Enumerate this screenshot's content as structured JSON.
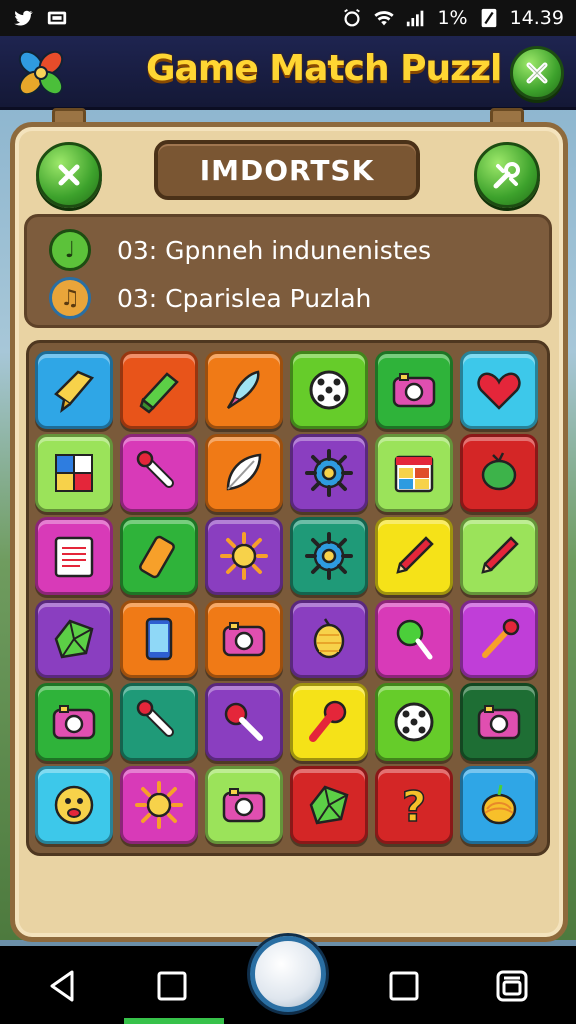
{
  "status_bar": {
    "battery_percent": "1%",
    "time": "14.39",
    "icons": [
      "twitter-icon",
      "mail-icon",
      "alarm-icon",
      "wifi-icon",
      "signal-icon",
      "battery-icon"
    ]
  },
  "header": {
    "title": "Game Match Puzzl",
    "logo_icon": "clover-leaf-icon",
    "close_icon": "close-icon"
  },
  "panel": {
    "name": "IMDORTSK",
    "close_icon": "close-icon",
    "tools_icon": "tools-icon",
    "info": [
      {
        "icon": "music-note-icon",
        "text": "03: Gpnneh indunenistes"
      },
      {
        "icon": "music-note-icon",
        "text": "03: Cparislea Puzlah"
      }
    ]
  },
  "grid": {
    "rows": 6,
    "cols": 6,
    "tiles": [
      {
        "icon": "ribbon-icon",
        "color": "#2fa6e6"
      },
      {
        "icon": "book-icon",
        "color": "#e8541a"
      },
      {
        "icon": "quill-icon",
        "color": "#f07a16"
      },
      {
        "icon": "dice-icon",
        "color": "#66cc2a"
      },
      {
        "icon": "camera-icon",
        "color": "#2fb33a"
      },
      {
        "icon": "heart-icon",
        "color": "#3dc8ea"
      },
      {
        "icon": "color-squares-icon",
        "color": "#9be35a"
      },
      {
        "icon": "brush-icon",
        "color": "#d83ab8"
      },
      {
        "icon": "feather-icon",
        "color": "#f07a16"
      },
      {
        "icon": "gear-icon",
        "color": "#8a3ec0"
      },
      {
        "icon": "calendar-icon",
        "color": "#9be35a"
      },
      {
        "icon": "fruit-icon",
        "color": "#d42626"
      },
      {
        "icon": "notepad-icon",
        "color": "#d83ab8"
      },
      {
        "icon": "battery-tile-icon",
        "color": "#2fb33a"
      },
      {
        "icon": "sun-icon",
        "color": "#8a3ec0"
      },
      {
        "icon": "gear-icon",
        "color": "#1f9a78"
      },
      {
        "icon": "pencil-icon",
        "color": "#f5e218"
      },
      {
        "icon": "pencil-icon",
        "color": "#9be35a"
      },
      {
        "icon": "gem-icon",
        "color": "#8a3ec0"
      },
      {
        "icon": "phone-icon",
        "color": "#f07a16"
      },
      {
        "icon": "camera-icon",
        "color": "#f07a16"
      },
      {
        "icon": "lemon-icon",
        "color": "#8a3ec0"
      },
      {
        "icon": "lollipop-icon",
        "color": "#d83ab8"
      },
      {
        "icon": "matchstick-icon",
        "color": "#c03ed8"
      },
      {
        "icon": "camera-icon",
        "color": "#2fb33a"
      },
      {
        "icon": "brush-icon",
        "color": "#1f9a78"
      },
      {
        "icon": "key-icon",
        "color": "#8a3ec0"
      },
      {
        "icon": "joystick-icon",
        "color": "#f5e218"
      },
      {
        "icon": "dice-icon",
        "color": "#66cc2a"
      },
      {
        "icon": "camera-icon",
        "color": "#1e6e34"
      },
      {
        "icon": "smiley-icon",
        "color": "#3dc8ea"
      },
      {
        "icon": "sun-icon",
        "color": "#d83ab8"
      },
      {
        "icon": "camera-icon",
        "color": "#9be35a"
      },
      {
        "icon": "gem-icon",
        "color": "#d42626"
      },
      {
        "icon": "question-icon",
        "color": "#d42626"
      },
      {
        "icon": "onion-icon",
        "color": "#2fa6e6"
      }
    ]
  },
  "nav": {
    "back_icon": "back-icon",
    "square_icon": "recent-apps-icon",
    "home_icon": "home-icon",
    "square2_icon": "overview-icon",
    "switch_icon": "switch-icon"
  }
}
